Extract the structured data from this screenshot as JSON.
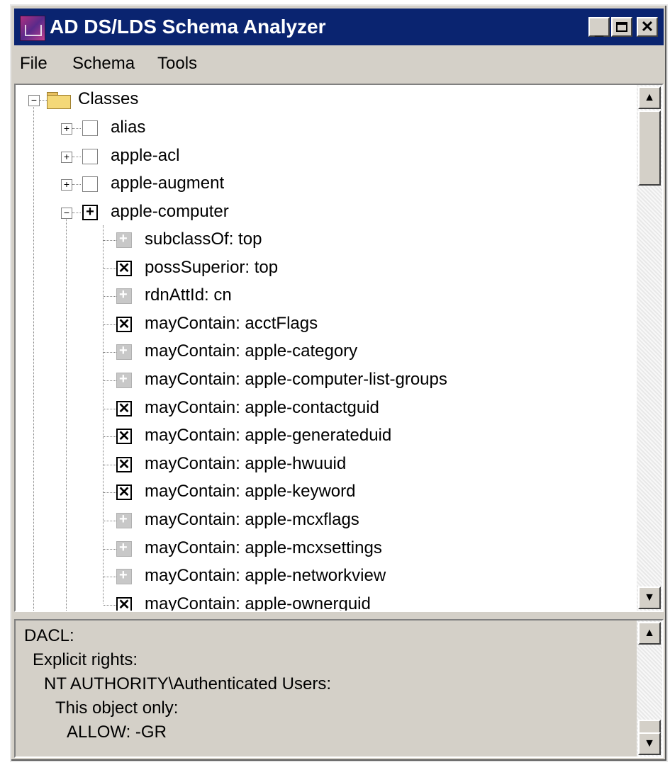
{
  "window": {
    "title": "AD DS/LDS Schema Analyzer"
  },
  "menu": [
    "File",
    "Schema",
    "Tools"
  ],
  "tree": {
    "root": "Classes",
    "classes": [
      {
        "label": "alias",
        "state": "empty"
      },
      {
        "label": "apple-acl",
        "state": "empty"
      },
      {
        "label": "apple-augment",
        "state": "empty"
      },
      {
        "label": "apple-computer",
        "state": "plus"
      }
    ],
    "children": [
      {
        "label": "subclassOf: top",
        "state": "gray"
      },
      {
        "label": "possSuperior: top",
        "state": "x"
      },
      {
        "label": "rdnAttId: cn",
        "state": "gray"
      },
      {
        "label": "mayContain: acctFlags",
        "state": "x"
      },
      {
        "label": "mayContain: apple-category",
        "state": "gray"
      },
      {
        "label": "mayContain: apple-computer-list-groups",
        "state": "gray"
      },
      {
        "label": "mayContain: apple-contactguid",
        "state": "x"
      },
      {
        "label": "mayContain: apple-generateduid",
        "state": "x"
      },
      {
        "label": "mayContain: apple-hwuuid",
        "state": "x"
      },
      {
        "label": "mayContain: apple-keyword",
        "state": "x"
      },
      {
        "label": "mayContain: apple-mcxflags",
        "state": "gray"
      },
      {
        "label": "mayContain: apple-mcxsettings",
        "state": "gray"
      },
      {
        "label": "mayContain: apple-networkview",
        "state": "gray"
      },
      {
        "label": "mayContain: apple-ownerguid",
        "state": "x"
      }
    ]
  },
  "detail": {
    "lines": [
      "DACL:",
      "Explicit rights:",
      "NT AUTHORITY\\Authenticated Users:",
      "This object only:",
      "ALLOW: -GR"
    ]
  }
}
